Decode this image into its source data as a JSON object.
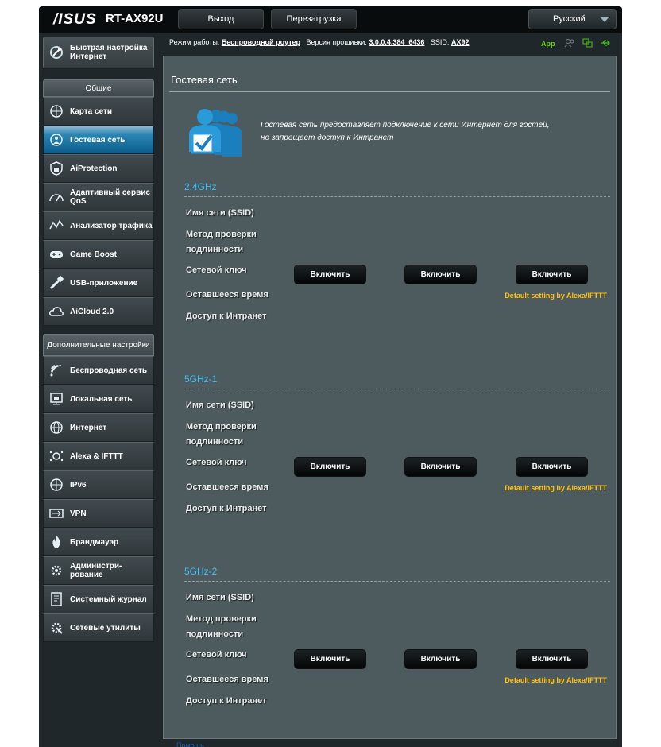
{
  "header": {
    "brand": "/ISUS",
    "model": "RT-AX92U",
    "logout_label": "Выход",
    "reboot_label": "Перезагрузка",
    "language": "Русский"
  },
  "status": {
    "mode_label": "Режим работы:",
    "mode_value": "Беспроводной роутер",
    "firmware_label": "Версия прошивки:",
    "firmware_value": "3.0.0.4.384_6436",
    "ssid_label": "SSID:",
    "ssid_value": "AX92",
    "app_label": "App"
  },
  "sidebar": {
    "qis_label": "Быстрая настройка Интернет",
    "general_header": "Общие",
    "general_items": [
      {
        "label": "Карта сети",
        "icon": "network-map-icon"
      },
      {
        "label": "Гостевая сеть",
        "icon": "guest-network-icon"
      },
      {
        "label": "AiProtection",
        "icon": "aiprotection-icon"
      },
      {
        "label": "Адаптивный сервис QoS",
        "icon": "qos-icon"
      },
      {
        "label": "Анализатор трафика",
        "icon": "traffic-analyzer-icon"
      },
      {
        "label": "Game Boost",
        "icon": "gamepad-icon"
      },
      {
        "label": "USB-приложение",
        "icon": "usb-icon"
      },
      {
        "label": "AiCloud 2.0",
        "icon": "cloud-icon"
      }
    ],
    "advanced_header": "Дополнительные настройки",
    "advanced_items": [
      {
        "label": "Беспроводная сеть",
        "icon": "wireless-icon"
      },
      {
        "label": "Локальная сеть",
        "icon": "lan-icon"
      },
      {
        "label": "Интернет",
        "icon": "internet-icon"
      },
      {
        "label": "Alexa & IFTTT",
        "icon": "alexa-icon"
      },
      {
        "label": "IPv6",
        "icon": "ipv6-icon"
      },
      {
        "label": "VPN",
        "icon": "vpn-icon"
      },
      {
        "label": "Брандмауэр",
        "icon": "firewall-icon"
      },
      {
        "label": "Администри-рование",
        "icon": "administration-icon"
      },
      {
        "label": "Системный журнал",
        "icon": "system-log-icon"
      },
      {
        "label": "Сетевые утилиты",
        "icon": "network-tools-icon"
      }
    ],
    "active_item": "Гостевая сеть"
  },
  "content": {
    "title": "Гостевая сеть",
    "intro_line1": "Гостевая сеть предоставляет подключение к сети Интернет для гостей,",
    "intro_line2": "но запрещает доступ к Интранет",
    "field_labels": {
      "ssid": "Имя сети (SSID)",
      "auth_line1": "Метод проверки",
      "auth_line2": "подлинности",
      "key": "Сетевой ключ",
      "time": "Оставшееся время",
      "intranet": "Доступ к Интранет"
    },
    "enable_label": "Включить",
    "alexa_note": "Default setting by Alexa/IFTTT",
    "bands": [
      {
        "name": "2.4GHz"
      },
      {
        "name": "5GHz-1"
      },
      {
        "name": "5GHz-2"
      }
    ]
  },
  "colors": {
    "active_blue": "#0b5d8c",
    "band_title": "#3fc0f5",
    "alexa_note": "#ffc20e",
    "app_green": "#6ad00f"
  }
}
